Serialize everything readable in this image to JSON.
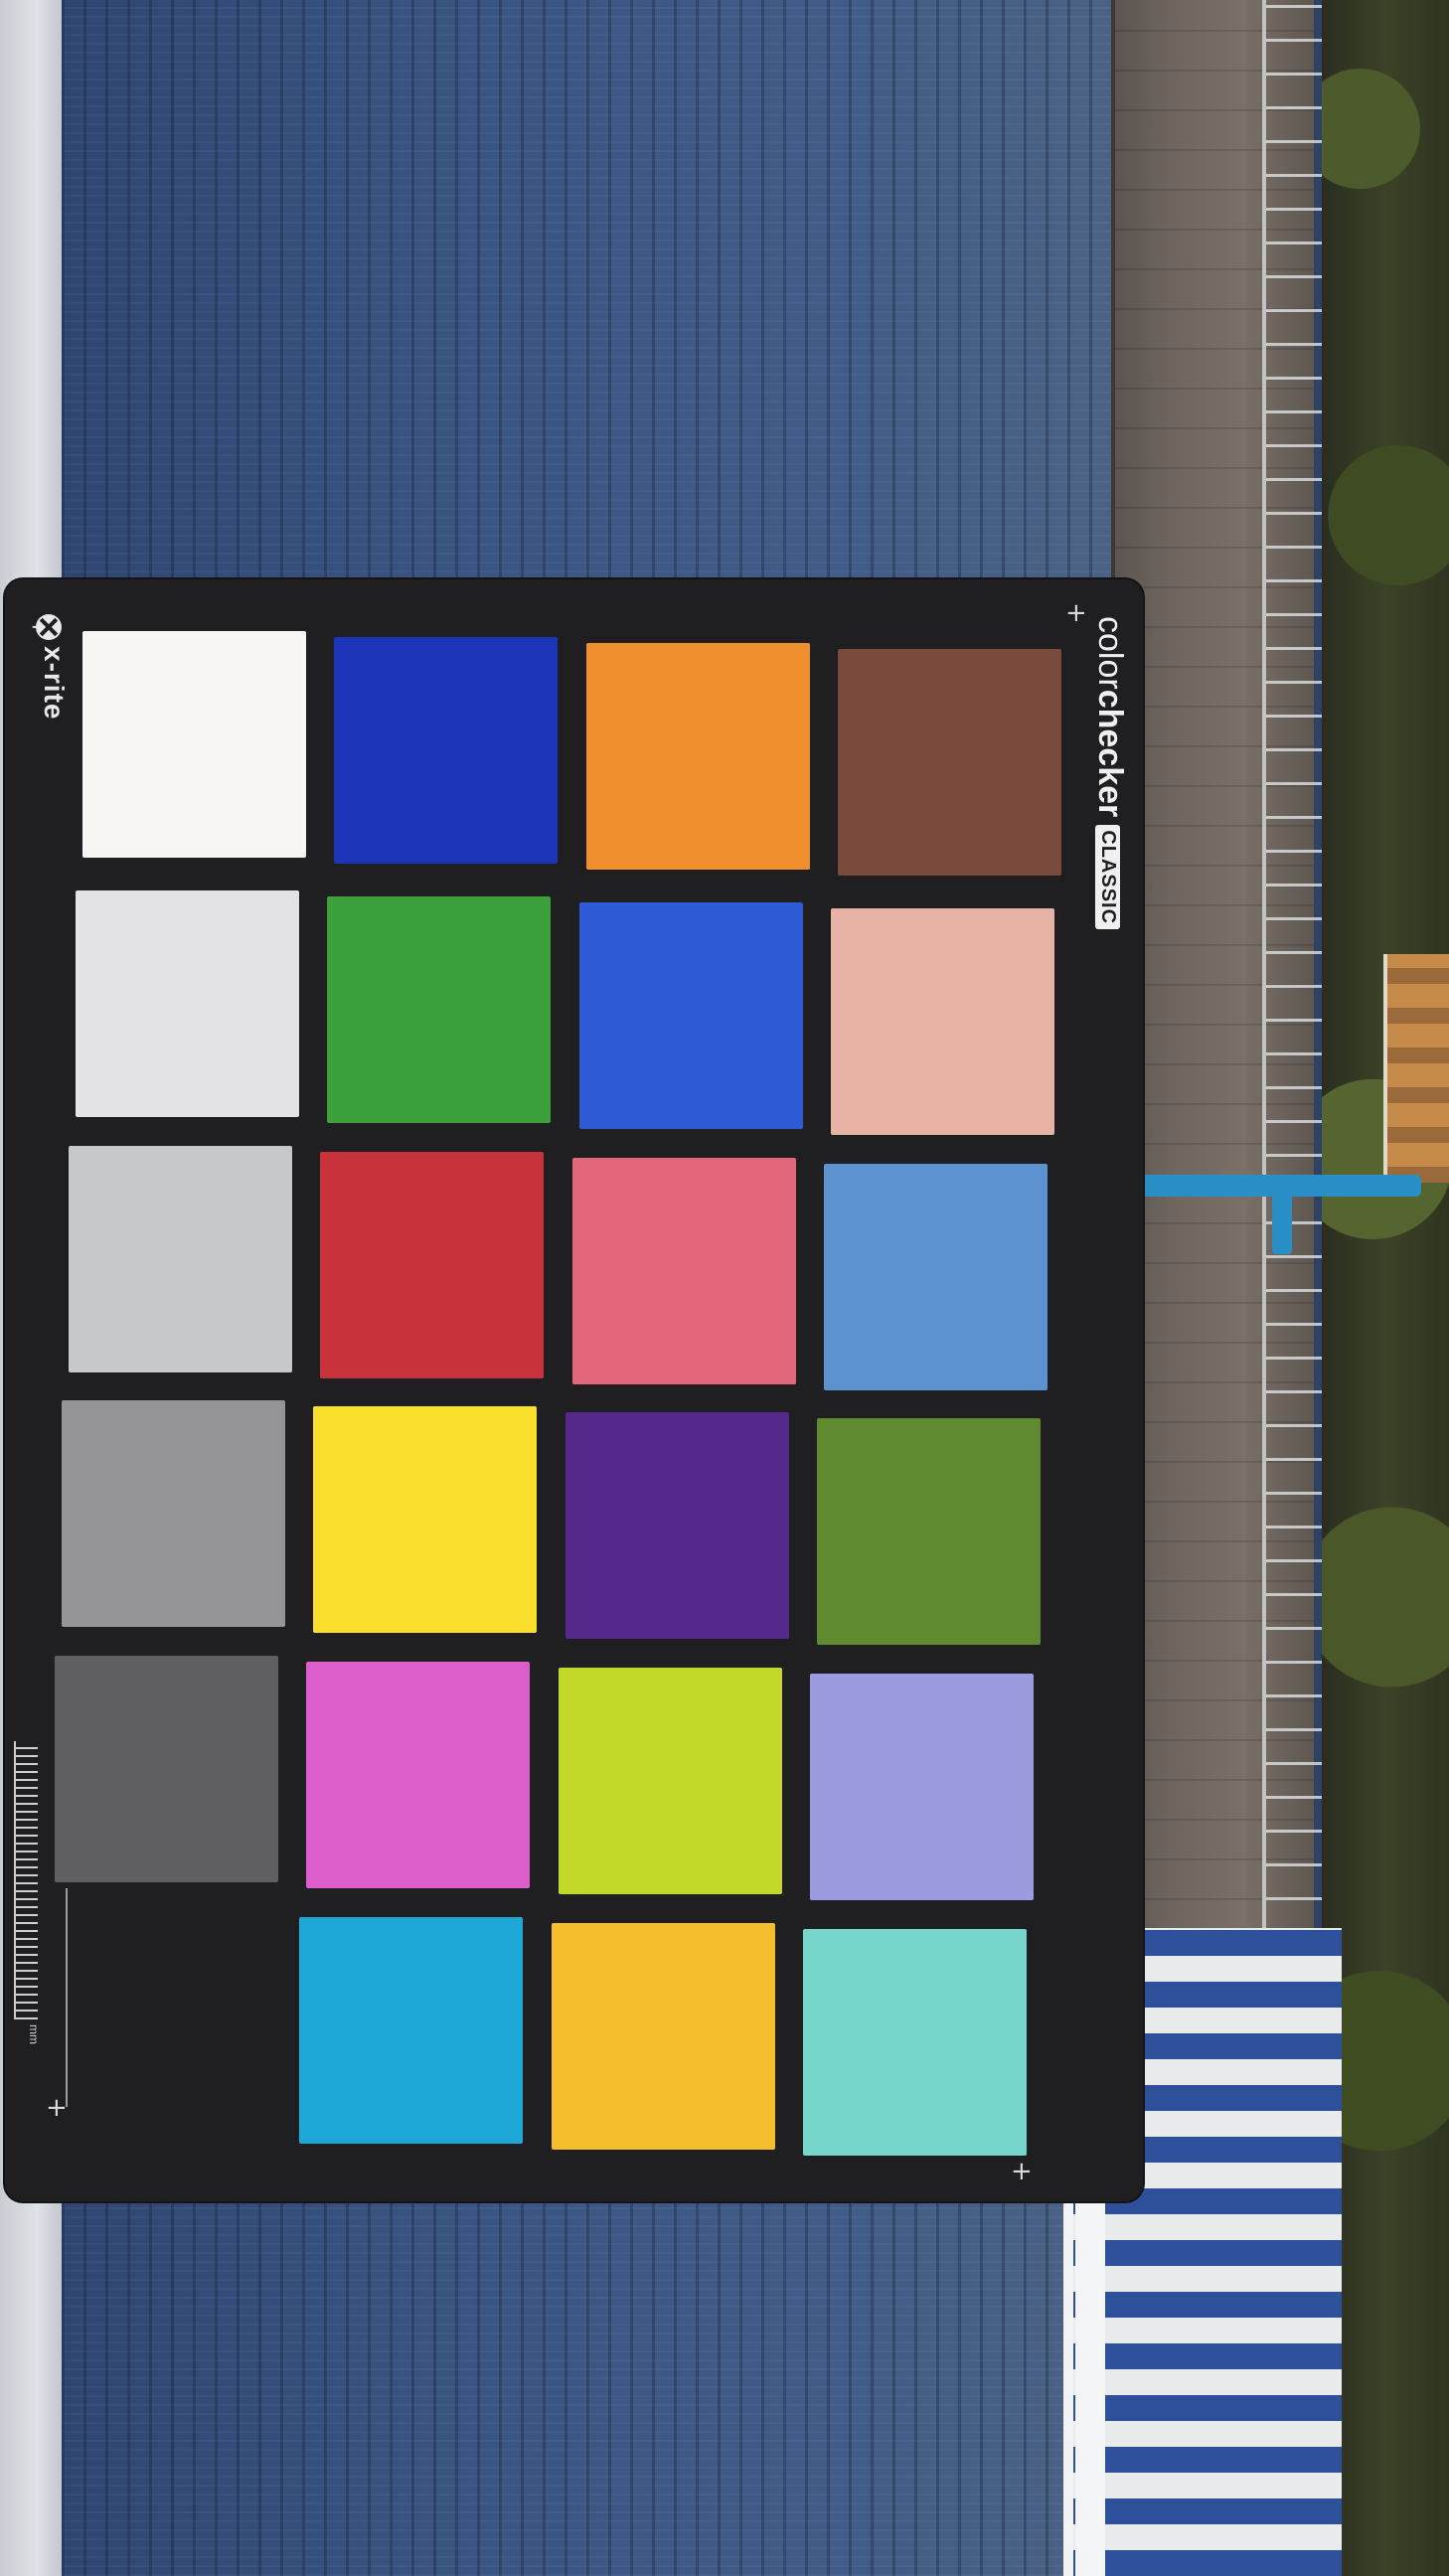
{
  "card": {
    "brand": "x-rite",
    "title_light": "color",
    "title_bold": "checker",
    "title_badge": "CLASSIC",
    "ruler_unit": "mm"
  },
  "patches": [
    {
      "row": 0,
      "col": 0,
      "name": "white",
      "color": "#f7f6f4"
    },
    {
      "row": 0,
      "col": 1,
      "name": "blue",
      "color": "#1c35b8"
    },
    {
      "row": 0,
      "col": 2,
      "name": "orange",
      "color": "#ef8f2d"
    },
    {
      "row": 0,
      "col": 3,
      "name": "dark-skin",
      "color": "#7a4b3c"
    },
    {
      "row": 1,
      "col": 0,
      "name": "neutral-8",
      "color": "#e3e3e5"
    },
    {
      "row": 1,
      "col": 1,
      "name": "green",
      "color": "#3ca13c"
    },
    {
      "row": 1,
      "col": 2,
      "name": "purplish-blue",
      "color": "#2f5ad6"
    },
    {
      "row": 1,
      "col": 3,
      "name": "light-skin",
      "color": "#e6b2a4"
    },
    {
      "row": 2,
      "col": 0,
      "name": "neutral-6-5",
      "color": "#c6c7cb"
    },
    {
      "row": 2,
      "col": 1,
      "name": "red",
      "color": "#c8323a"
    },
    {
      "row": 2,
      "col": 2,
      "name": "moderate-red",
      "color": "#e2677b"
    },
    {
      "row": 2,
      "col": 3,
      "name": "blue-sky",
      "color": "#5b92cf"
    },
    {
      "row": 3,
      "col": 0,
      "name": "neutral-5",
      "color": "#959597"
    },
    {
      "row": 3,
      "col": 1,
      "name": "yellow",
      "color": "#f7df2c"
    },
    {
      "row": 3,
      "col": 2,
      "name": "purple",
      "color": "#55298c"
    },
    {
      "row": 3,
      "col": 3,
      "name": "foliage",
      "color": "#5f8a2f"
    },
    {
      "row": 4,
      "col": 0,
      "name": "neutral-3-5",
      "color": "#5f5f62"
    },
    {
      "row": 4,
      "col": 1,
      "name": "magenta",
      "color": "#db5ecb"
    },
    {
      "row": 4,
      "col": 2,
      "name": "yellow-green",
      "color": "#c3d92a"
    },
    {
      "row": 4,
      "col": 3,
      "name": "blue-flower",
      "color": "#9b9be0"
    },
    {
      "row": 5,
      "col": 0,
      "name": "black",
      "color": "#1f1f21"
    },
    {
      "row": 5,
      "col": 1,
      "name": "cyan",
      "color": "#1ea8d8"
    },
    {
      "row": 5,
      "col": 2,
      "name": "orange-yellow",
      "color": "#f5be2d"
    },
    {
      "row": 5,
      "col": 3,
      "name": "bluish-green",
      "color": "#77d7cd"
    }
  ]
}
